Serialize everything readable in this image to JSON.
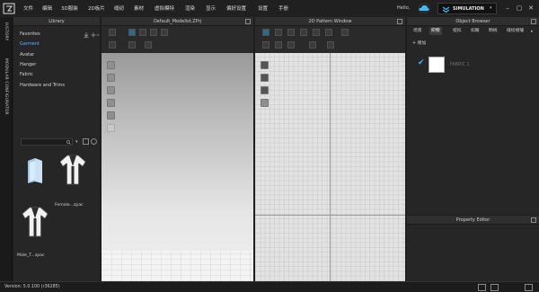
{
  "app": {
    "menu": [
      "文件",
      "编辑",
      "3D服装",
      "2D板片",
      "缝纫",
      "素材",
      "虚拟模特",
      "渲染",
      "显示",
      "偏好设置",
      "设置",
      "手册"
    ],
    "hello": "Hello,",
    "simulation": "SIMULATION",
    "accent_color": "#39b6ff"
  },
  "rail": {
    "history": "HISTORY",
    "modular": "MODULAR CONFIGURATOR"
  },
  "library": {
    "title": "Library",
    "items": [
      "Favorites",
      "Garment",
      "Avatar",
      "Hanger",
      "Fabric",
      "Hardware and Trims"
    ],
    "thumbs": [
      {
        "caption": "..",
        "icon": "folder-icon"
      },
      {
        "caption": "Female...zpac",
        "icon": "shirt-icon"
      },
      {
        "caption": "Male_T...zpac",
        "icon": "shirt-icon"
      }
    ]
  },
  "window3d": {
    "title": "Default_Modelist.ZPrj"
  },
  "window2d": {
    "title": "2D Pattern Window"
  },
  "object_browser": {
    "title": "Object Browser",
    "tabs": [
      "场景",
      "织物",
      "纽扣",
      "扣眼",
      "明线",
      "缝纫褶皱"
    ],
    "add_label": "+ 增加",
    "item_name": "FABRIC 1"
  },
  "property_editor": {
    "title": "Property Editor"
  },
  "status": {
    "version": "Version: 5.0.100 (r36285)"
  }
}
